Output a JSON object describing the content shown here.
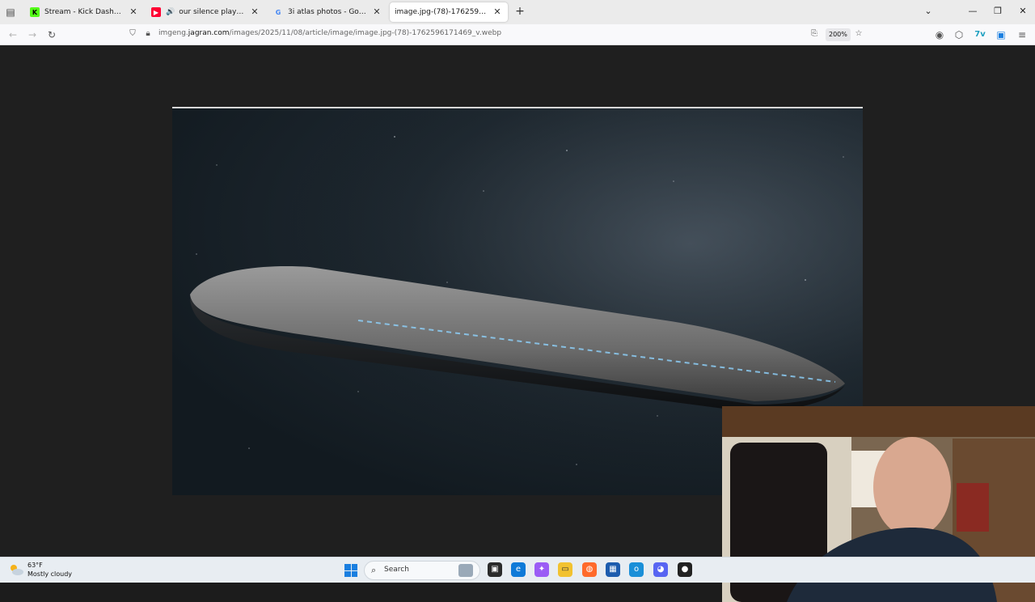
{
  "browser": {
    "tabs": [
      {
        "title": "Stream - Kick Dashboard",
        "favicon": "kick-icon",
        "active": false
      },
      {
        "title": "our silence played like jazz",
        "favicon": "youtube-icon",
        "audio": true,
        "active": false
      },
      {
        "title": "3i atlas photos - Google Search",
        "favicon": "google-icon",
        "active": false
      },
      {
        "title": "image.jpg-(78)-1762596171469_v.webp",
        "favicon": "none",
        "active": true
      }
    ],
    "url": {
      "prefix": "imgeng.",
      "domain": "jagran.com",
      "path": "/images/2025/11/08/article/image/image.jpg-(78)-1762596171469_v.webp"
    },
    "zoom": "200%"
  },
  "taskbar": {
    "weather": {
      "temp": "63°F",
      "condition": "Mostly cloudy"
    },
    "search_label": "Search"
  },
  "colors": {
    "kick": "#53fc18",
    "youtube": "#ff0033",
    "windows_accent": "#1a7fe0"
  }
}
